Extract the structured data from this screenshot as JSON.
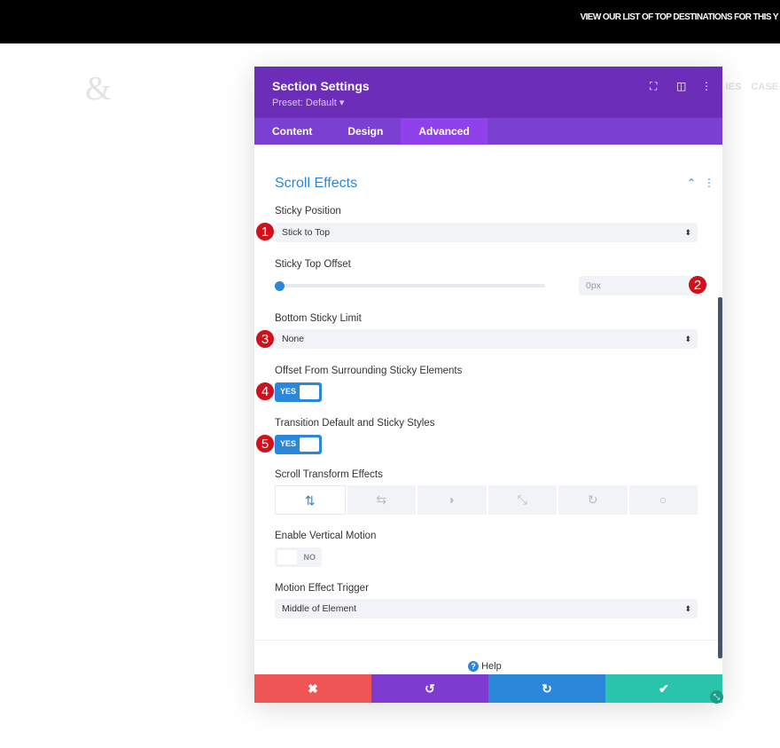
{
  "banner": "VIEW OUR LIST OF TOP DESTINATIONS FOR THIS Y",
  "logo": "&",
  "nav": "IES CASE",
  "modal": {
    "title": "Section Settings",
    "preset": "Preset: Default ▾",
    "tabs": [
      "Content",
      "Design",
      "Advanced"
    ],
    "active_tab": "Advanced",
    "section_title": "Scroll Effects",
    "sticky_position": {
      "label": "Sticky Position",
      "value": "Stick to Top"
    },
    "sticky_top_offset": {
      "label": "Sticky Top Offset",
      "value": "0px",
      "slider": 0
    },
    "bottom_sticky_limit": {
      "label": "Bottom Sticky Limit",
      "value": "None"
    },
    "offset_surrounding": {
      "label": "Offset From Surrounding Sticky Elements",
      "value": "YES"
    },
    "transition_styles": {
      "label": "Transition Default and Sticky Styles",
      "value": "YES"
    },
    "scroll_transform": {
      "label": "Scroll Transform Effects",
      "icons": [
        "vertical-motion-icon",
        "horizontal-motion-icon",
        "fade-icon",
        "scale-icon",
        "rotate-icon",
        "blur-icon"
      ]
    },
    "vertical_motion": {
      "label": "Enable Vertical Motion",
      "value": "NO"
    },
    "motion_trigger": {
      "label": "Motion Effect Trigger",
      "value": "Middle of Element"
    },
    "help": "Help",
    "badges": [
      "1",
      "2",
      "3",
      "4",
      "5"
    ]
  },
  "colors": {
    "header": "#6c2eb9",
    "tabs": "#7b3fd1",
    "accent": "#2b87da",
    "cancel": "#ef5555",
    "undo": "#7e3bd0",
    "redo": "#2b87da",
    "save": "#29c4a9",
    "badge": "#d0111c"
  }
}
